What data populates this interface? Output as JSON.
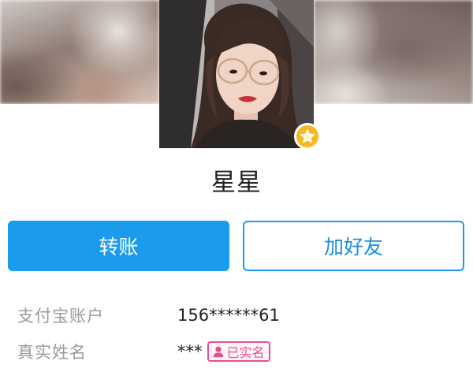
{
  "profile": {
    "name": "星星",
    "badge_icon": "star-icon",
    "badge_color": "#f6b81e"
  },
  "actions": {
    "transfer_label": "转账",
    "add_friend_label": "加好友",
    "primary_color": "#1b9bec"
  },
  "info": {
    "account_label": "支付宝账户",
    "account_value": "156******61",
    "realname_label": "真实姓名",
    "realname_value": "***",
    "verified_label": "已实名",
    "verified_icon": "person-icon",
    "verified_color": "#e6508f"
  }
}
